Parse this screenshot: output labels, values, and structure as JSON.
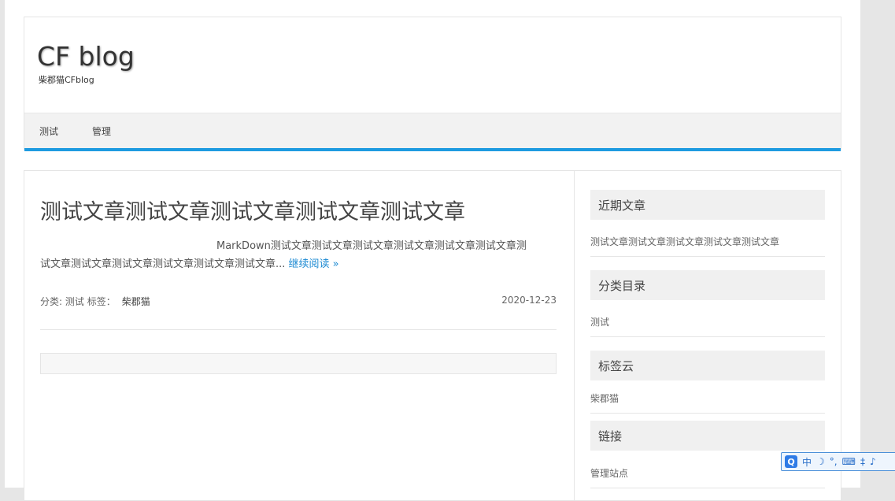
{
  "site": {
    "title": "CF blog",
    "description": "柴郡猫CFblog"
  },
  "nav": {
    "items": [
      {
        "label": "测试"
      },
      {
        "label": "管理"
      }
    ]
  },
  "post": {
    "title": "测试文章测试文章测试文章测试文章测试文章",
    "excerpt_line1": "MarkDown测试文章测试文章测试文章测试文章测试文章测试文章测",
    "excerpt_line2": "试文章测试文章测试文章测试文章测试文章测试文章...",
    "read_more": "继续阅读 »",
    "category_label": "分类:",
    "category": "测试",
    "tags_label": "标签：",
    "tag": "柴郡猫",
    "date": "2020-12-23"
  },
  "sidebar": {
    "recent": {
      "title": "近期文章",
      "items": [
        "测试文章测试文章测试文章测试文章测试文章"
      ]
    },
    "categories": {
      "title": "分类目录",
      "items": [
        "测试"
      ]
    },
    "tags": {
      "title": "标签云",
      "items": [
        "柴郡猫"
      ]
    },
    "links": {
      "title": "链接",
      "items": [
        "管理站点"
      ]
    }
  },
  "ime": {
    "logo": "Q",
    "mode": "中",
    "moon_icon": "☽",
    "punct": "°,",
    "keyboard_icon": "⌨",
    "width_icon": "‡",
    "more_icon": "♪"
  },
  "colors": {
    "accent": "#1e9be0",
    "link": "#1e8bd3"
  }
}
